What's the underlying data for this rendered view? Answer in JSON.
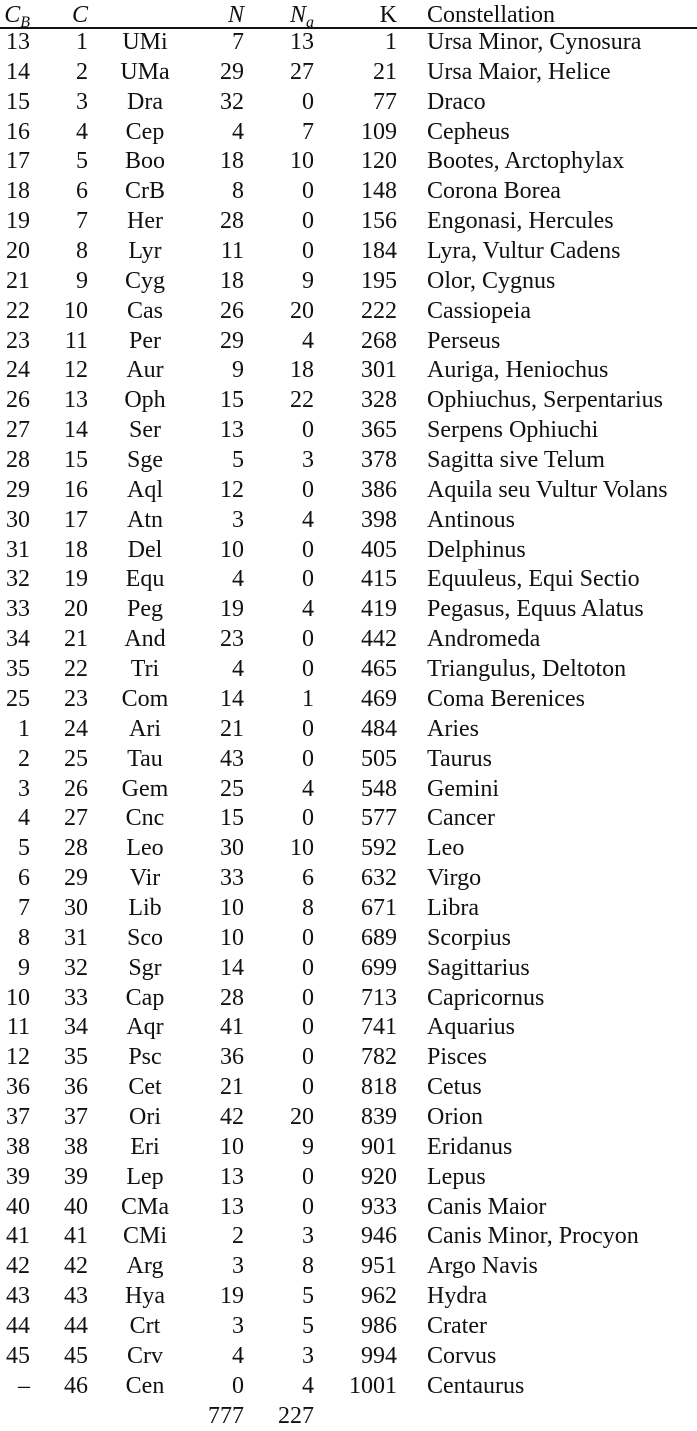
{
  "table": {
    "headers": {
      "cb_main": "C",
      "cb_sub": "B",
      "c": "C",
      "abbr": "",
      "n": "N",
      "na_main": "N",
      "na_sub": "a",
      "k": "K",
      "constellation": "Constellation"
    },
    "rows": [
      [
        "13",
        "1",
        "UMi",
        "7",
        "13",
        "1",
        "Ursa Minor, Cynosura"
      ],
      [
        "14",
        "2",
        "UMa",
        "29",
        "27",
        "21",
        "Ursa Maior, Helice"
      ],
      [
        "15",
        "3",
        "Dra",
        "32",
        "0",
        "77",
        "Draco"
      ],
      [
        "16",
        "4",
        "Cep",
        "4",
        "7",
        "109",
        "Cepheus"
      ],
      [
        "17",
        "5",
        "Boo",
        "18",
        "10",
        "120",
        "Bootes, Arctophylax"
      ],
      [
        "18",
        "6",
        "CrB",
        "8",
        "0",
        "148",
        "Corona Borea"
      ],
      [
        "19",
        "7",
        "Her",
        "28",
        "0",
        "156",
        "Engonasi, Hercules"
      ],
      [
        "20",
        "8",
        "Lyr",
        "11",
        "0",
        "184",
        "Lyra, Vultur Cadens"
      ],
      [
        "21",
        "9",
        "Cyg",
        "18",
        "9",
        "195",
        "Olor, Cygnus"
      ],
      [
        "22",
        "10",
        "Cas",
        "26",
        "20",
        "222",
        "Cassiopeia"
      ],
      [
        "23",
        "11",
        "Per",
        "29",
        "4",
        "268",
        "Perseus"
      ],
      [
        "24",
        "12",
        "Aur",
        "9",
        "18",
        "301",
        "Auriga, Heniochus"
      ],
      [
        "26",
        "13",
        "Oph",
        "15",
        "22",
        "328",
        "Ophiuchus, Serpentarius"
      ],
      [
        "27",
        "14",
        "Ser",
        "13",
        "0",
        "365",
        "Serpens Ophiuchi"
      ],
      [
        "28",
        "15",
        "Sge",
        "5",
        "3",
        "378",
        "Sagitta sive Telum"
      ],
      [
        "29",
        "16",
        "Aql",
        "12",
        "0",
        "386",
        "Aquila seu Vultur Volans"
      ],
      [
        "30",
        "17",
        "Atn",
        "3",
        "4",
        "398",
        "Antinous"
      ],
      [
        "31",
        "18",
        "Del",
        "10",
        "0",
        "405",
        "Delphinus"
      ],
      [
        "32",
        "19",
        "Equ",
        "4",
        "0",
        "415",
        "Equuleus, Equi Sectio"
      ],
      [
        "33",
        "20",
        "Peg",
        "19",
        "4",
        "419",
        "Pegasus, Equus Alatus"
      ],
      [
        "34",
        "21",
        "And",
        "23",
        "0",
        "442",
        "Andromeda"
      ],
      [
        "35",
        "22",
        "Tri",
        "4",
        "0",
        "465",
        "Triangulus, Deltoton"
      ],
      [
        "25",
        "23",
        "Com",
        "14",
        "1",
        "469",
        "Coma Berenices"
      ],
      [
        "1",
        "24",
        "Ari",
        "21",
        "0",
        "484",
        "Aries"
      ],
      [
        "2",
        "25",
        "Tau",
        "43",
        "0",
        "505",
        "Taurus"
      ],
      [
        "3",
        "26",
        "Gem",
        "25",
        "4",
        "548",
        "Gemini"
      ],
      [
        "4",
        "27",
        "Cnc",
        "15",
        "0",
        "577",
        "Cancer"
      ],
      [
        "5",
        "28",
        "Leo",
        "30",
        "10",
        "592",
        "Leo"
      ],
      [
        "6",
        "29",
        "Vir",
        "33",
        "6",
        "632",
        "Virgo"
      ],
      [
        "7",
        "30",
        "Lib",
        "10",
        "8",
        "671",
        "Libra"
      ],
      [
        "8",
        "31",
        "Sco",
        "10",
        "0",
        "689",
        "Scorpius"
      ],
      [
        "9",
        "32",
        "Sgr",
        "14",
        "0",
        "699",
        "Sagittarius"
      ],
      [
        "10",
        "33",
        "Cap",
        "28",
        "0",
        "713",
        "Capricornus"
      ],
      [
        "11",
        "34",
        "Aqr",
        "41",
        "0",
        "741",
        "Aquarius"
      ],
      [
        "12",
        "35",
        "Psc",
        "36",
        "0",
        "782",
        "Pisces"
      ],
      [
        "36",
        "36",
        "Cet",
        "21",
        "0",
        "818",
        "Cetus"
      ],
      [
        "37",
        "37",
        "Ori",
        "42",
        "20",
        "839",
        "Orion"
      ],
      [
        "38",
        "38",
        "Eri",
        "10",
        "9",
        "901",
        "Eridanus"
      ],
      [
        "39",
        "39",
        "Lep",
        "13",
        "0",
        "920",
        "Lepus"
      ],
      [
        "40",
        "40",
        "CMa",
        "13",
        "0",
        "933",
        "Canis Maior"
      ],
      [
        "41",
        "41",
        "CMi",
        "2",
        "3",
        "946",
        "Canis Minor, Procyon"
      ],
      [
        "42",
        "42",
        "Arg",
        "3",
        "8",
        "951",
        "Argo Navis"
      ],
      [
        "43",
        "43",
        "Hya",
        "19",
        "5",
        "962",
        "Hydra"
      ],
      [
        "44",
        "44",
        "Crt",
        "3",
        "5",
        "986",
        "Crater"
      ],
      [
        "45",
        "45",
        "Crv",
        "4",
        "3",
        "994",
        "Corvus"
      ],
      [
        "–",
        "46",
        "Cen",
        "0",
        "4",
        "1001",
        "Centaurus"
      ]
    ],
    "totals": {
      "n": "777",
      "na": "227"
    }
  }
}
